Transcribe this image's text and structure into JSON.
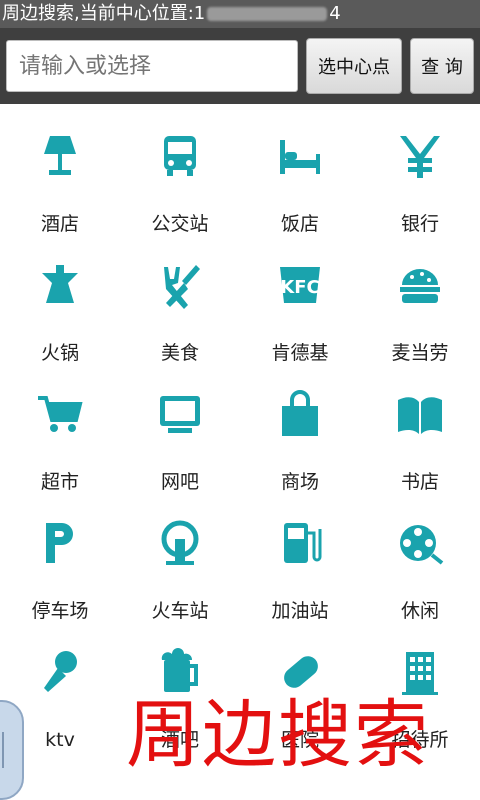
{
  "titlebar": {
    "prefix": "周边搜索,当前中心位置:1",
    "suffix": "4"
  },
  "search": {
    "placeholder": "请输入或选择",
    "value": ""
  },
  "buttons": {
    "center": "选中心点",
    "query": "查 询"
  },
  "icon_color": "#1aa3ad",
  "categories": [
    {
      "label": "酒店",
      "icon": "lamp-icon"
    },
    {
      "label": "公交站",
      "icon": "bus-icon"
    },
    {
      "label": "饭店",
      "icon": "bed-icon"
    },
    {
      "label": "银行",
      "icon": "yen-icon"
    },
    {
      "label": "火锅",
      "icon": "hotpot-icon"
    },
    {
      "label": "美食",
      "icon": "fork-knife-icon"
    },
    {
      "label": "肯德基",
      "icon": "kfc-icon"
    },
    {
      "label": "麦当劳",
      "icon": "burger-icon"
    },
    {
      "label": "超市",
      "icon": "cart-icon"
    },
    {
      "label": "网吧",
      "icon": "monitor-icon"
    },
    {
      "label": "商场",
      "icon": "shopping-bag-icon"
    },
    {
      "label": "书店",
      "icon": "book-icon"
    },
    {
      "label": "停车场",
      "icon": "parking-icon"
    },
    {
      "label": "火车站",
      "icon": "train-icon"
    },
    {
      "label": "加油站",
      "icon": "fuel-pump-icon"
    },
    {
      "label": "休闲",
      "icon": "film-reel-icon"
    },
    {
      "label": "ktv",
      "icon": "microphone-icon"
    },
    {
      "label": "酒吧",
      "icon": "beer-icon"
    },
    {
      "label": "医院",
      "icon": "pill-icon"
    },
    {
      "label": "招待所",
      "icon": "building-icon"
    }
  ],
  "overlay_text": "周边搜索"
}
